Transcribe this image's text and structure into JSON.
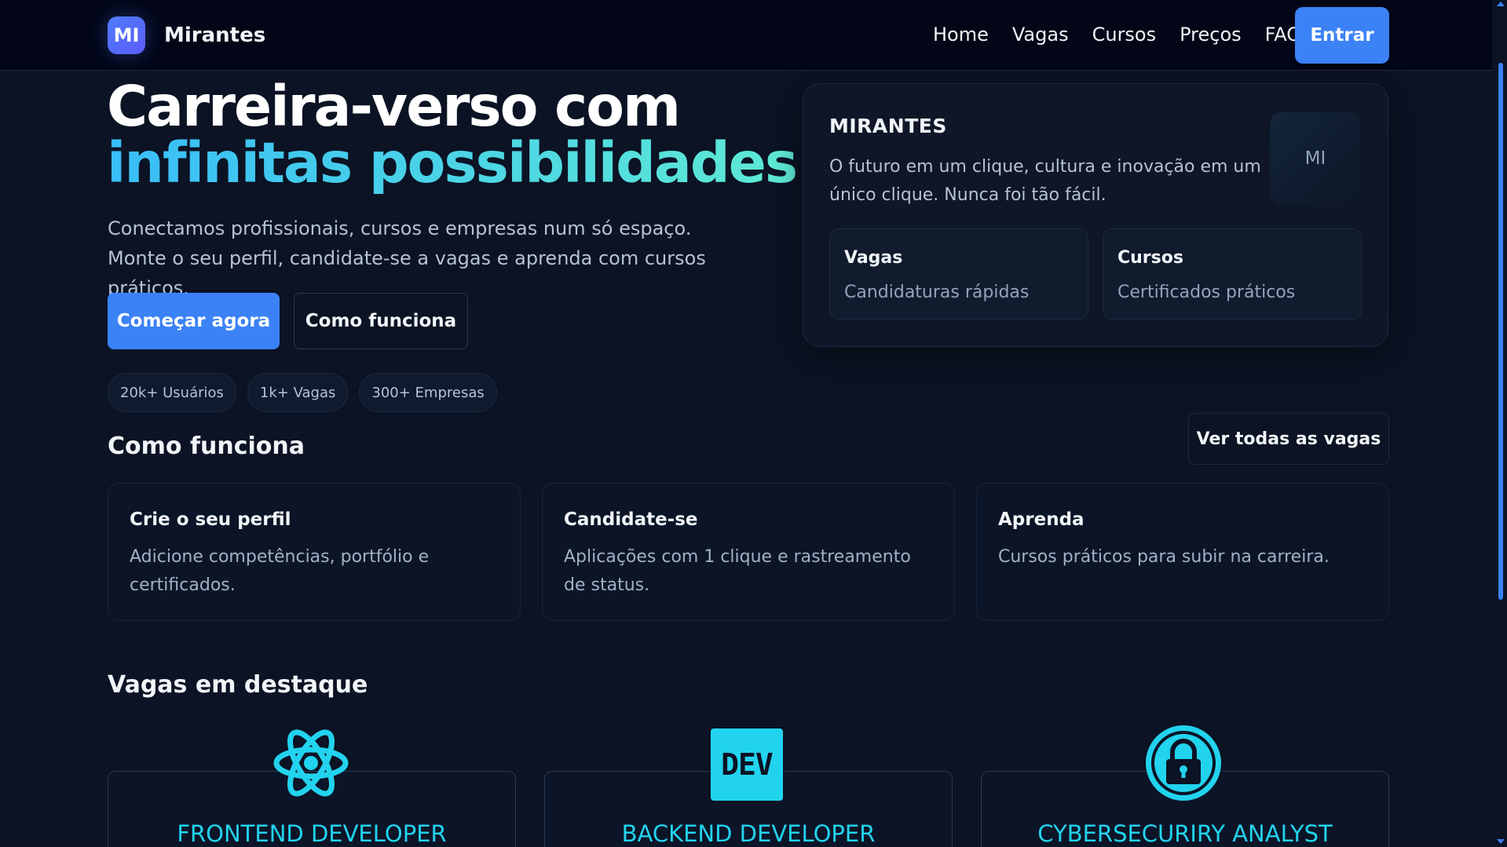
{
  "nav": {
    "brand_logo": "MI",
    "brand_name": "Mirantes",
    "links": [
      "Home",
      "Vagas",
      "Cursos",
      "Preços",
      "FAQ"
    ],
    "login_label": "Entrar"
  },
  "hero": {
    "title_line1": "Carreira-verso com",
    "title_line2": "infinitas possibilidades",
    "subtitle": "Conectamos profissionais, cursos e empresas num só espaço. Monte o seu perfil, candidate-se a vagas e aprenda com cursos práticos.",
    "primary_cta": "Começar agora",
    "secondary_cta": "Como funciona",
    "stats": [
      "20k+ Usuários",
      "1k+ Vagas",
      "300+ Empresas"
    ]
  },
  "hero_card": {
    "title": "MIRANTES",
    "description": "O futuro em um clique, cultura e inovação em um único clique. Nunca foi tão fácil.",
    "avatar": "MI",
    "tiles": [
      {
        "title": "Vagas",
        "subtitle": "Candidaturas rápidas"
      },
      {
        "title": "Cursos",
        "subtitle": "Certificados práticos"
      }
    ]
  },
  "how_it_works": {
    "title": "Como funciona",
    "view_all_label": "Ver todas as vagas",
    "steps": [
      {
        "title": "Crie o seu perfil",
        "description": "Adicione competências, portfólio e certificados."
      },
      {
        "title": "Candidate-se",
        "description": "Aplicações com 1 clique e rastreamento de status."
      },
      {
        "title": "Aprenda",
        "description": "Cursos práticos para subir na carreira."
      }
    ]
  },
  "featured_jobs": {
    "title": "Vagas em destaque",
    "jobs": [
      {
        "title": "FRONTEND DEVELOPER",
        "icon": "react-atom-icon"
      },
      {
        "title": "BACKEND DEVELOPER",
        "icon": "dev-badge-icon",
        "icon_text": "DEV"
      },
      {
        "title": "CYBERSECURIRY ANALYST",
        "icon": "padlock-icon"
      }
    ]
  },
  "colors": {
    "background": "#0b1324",
    "navbar": "#020617",
    "accent": "#3b82f6",
    "gradient_start": "#38bdf8",
    "gradient_end": "#5eead4",
    "job_title": "#22d3ee"
  }
}
